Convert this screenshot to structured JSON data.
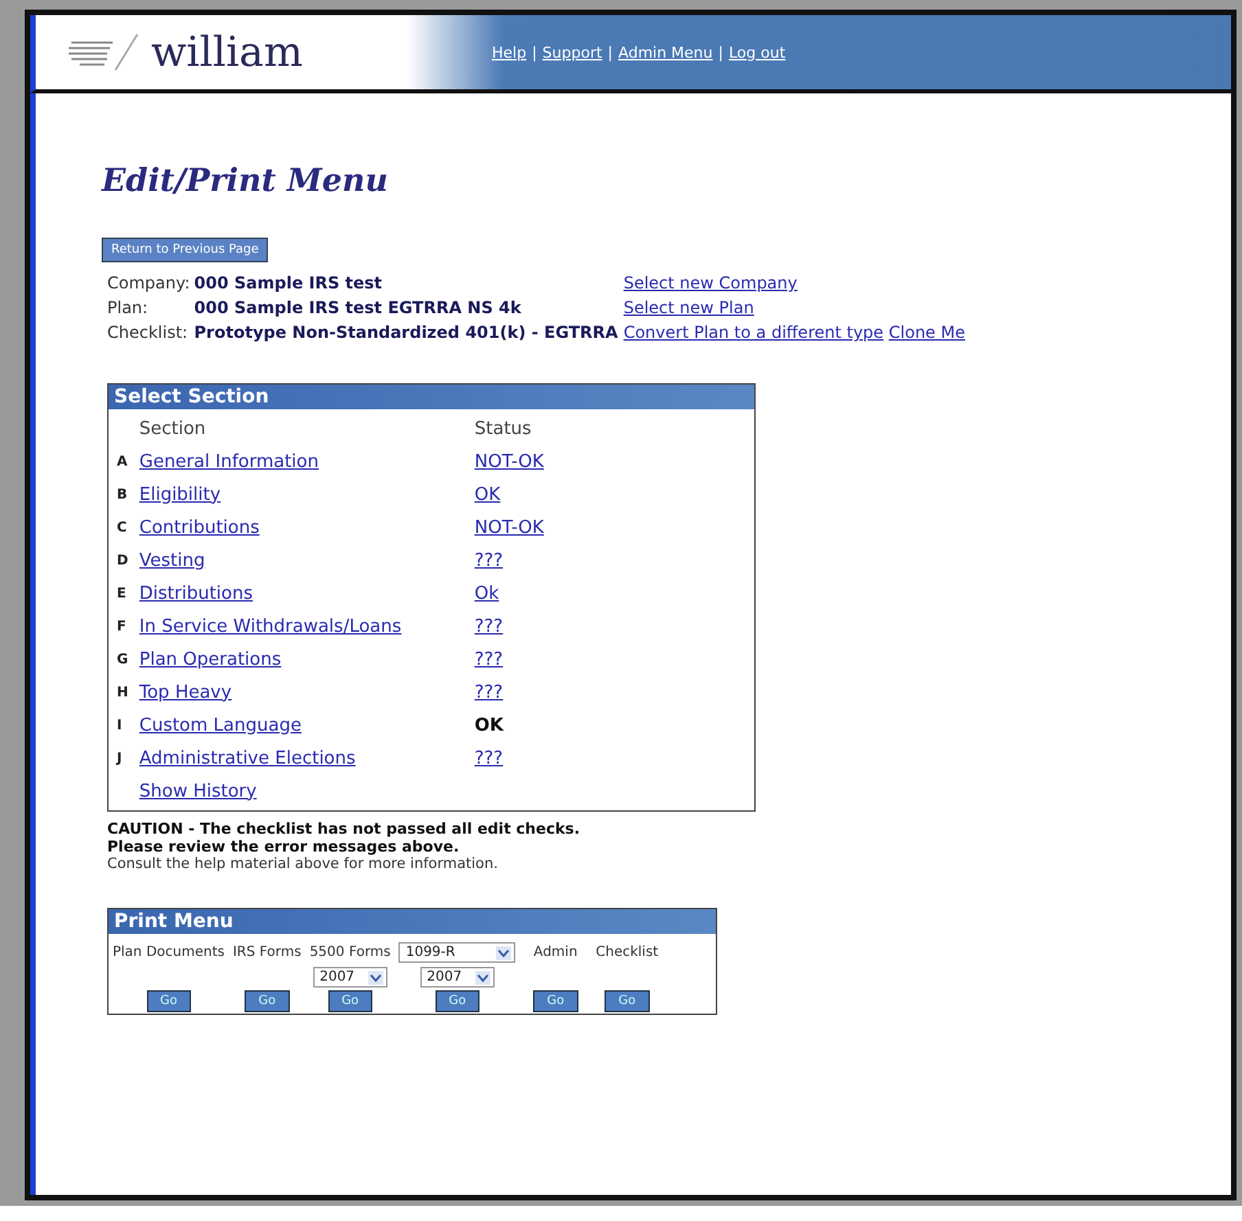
{
  "header": {
    "logo": "william",
    "links": [
      "Help",
      "Support",
      "Admin Menu",
      "Log out"
    ],
    "separator": "|"
  },
  "title": "Edit/Print Menu",
  "return_button": "Return to Previous Page",
  "info": [
    {
      "label": "Company:",
      "value": "000 Sample IRS test",
      "links": [
        "Select new Company"
      ]
    },
    {
      "label": "Plan:",
      "value": "000 Sample IRS test EGTRRA NS 4k",
      "links": [
        "Select new Plan"
      ]
    },
    {
      "label": "Checklist:",
      "value": "Prototype Non-Standardized 401(k) - EGTRRA",
      "links": [
        "Convert Plan to a different type",
        "Clone Me"
      ]
    }
  ],
  "select_section": {
    "title": "Select Section",
    "columns": [
      "Section",
      "Status"
    ],
    "rows": [
      {
        "letter": "A",
        "name": "General Information",
        "status": "NOT-OK",
        "kind": "link"
      },
      {
        "letter": "B",
        "name": "Eligibility",
        "status": "OK",
        "kind": "link"
      },
      {
        "letter": "C",
        "name": "Contributions",
        "status": "NOT-OK",
        "kind": "link"
      },
      {
        "letter": "D",
        "name": "Vesting",
        "status": "???",
        "kind": "link"
      },
      {
        "letter": "E",
        "name": "Distributions",
        "status": "Ok",
        "kind": "link"
      },
      {
        "letter": "F",
        "name": "In Service Withdrawals/Loans",
        "status": "???",
        "kind": "link"
      },
      {
        "letter": "G",
        "name": "Plan Operations",
        "status": "???",
        "kind": "link"
      },
      {
        "letter": "H",
        "name": "Top Heavy",
        "status": "???",
        "kind": "link"
      },
      {
        "letter": "I",
        "name": "Custom Language",
        "status": "OK",
        "kind": "plain"
      },
      {
        "letter": "J",
        "name": "Administrative Elections",
        "status": "???",
        "kind": "link"
      }
    ],
    "history_link": "Show History"
  },
  "caution": [
    "CAUTION - The checklist has not passed all edit checks.",
    "Please review the error messages above."
  ],
  "consult": "Consult the help material above for more information.",
  "print_menu": {
    "title": "Print Menu",
    "columns": [
      {
        "label": "Plan Documents",
        "button": "Go"
      },
      {
        "label": "IRS Forms",
        "button": "Go"
      },
      {
        "label": "5500 Forms",
        "year": "2007",
        "button": "Go"
      },
      {
        "select": "1099-R",
        "year": "2007",
        "button": "Go"
      },
      {
        "label": "Admin",
        "button": "Go"
      },
      {
        "label": "Checklist",
        "button": "Go"
      }
    ]
  }
}
